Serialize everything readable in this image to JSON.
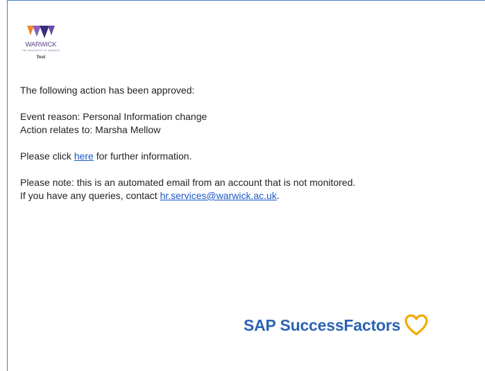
{
  "logo": {
    "name": "WARWICK",
    "subtitle": "THE UNIVERSITY OF WARWICK",
    "env": "Test",
    "colors": [
      "#f08a2c",
      "#8b5fbf",
      "#3a2f7a"
    ]
  },
  "email": {
    "intro": "The following action has been approved:",
    "event_reason": "Event reason: Personal Information change",
    "action_relates": "Action relates to: Marsha Mellow",
    "click_prefix": "Please click ",
    "click_link": "here",
    "click_suffix": " for further information.",
    "note_line": "Please note: this is an automated email from an account that is not monitored.",
    "queries_prefix": "If you have any queries, contact ",
    "queries_email": "hr.services@warwick.ac.uk",
    "queries_suffix": "."
  },
  "footer": {
    "brand": "SAP SuccessFactors",
    "brand_color": "#2b63b4",
    "heart_color": "#f0ab00"
  }
}
